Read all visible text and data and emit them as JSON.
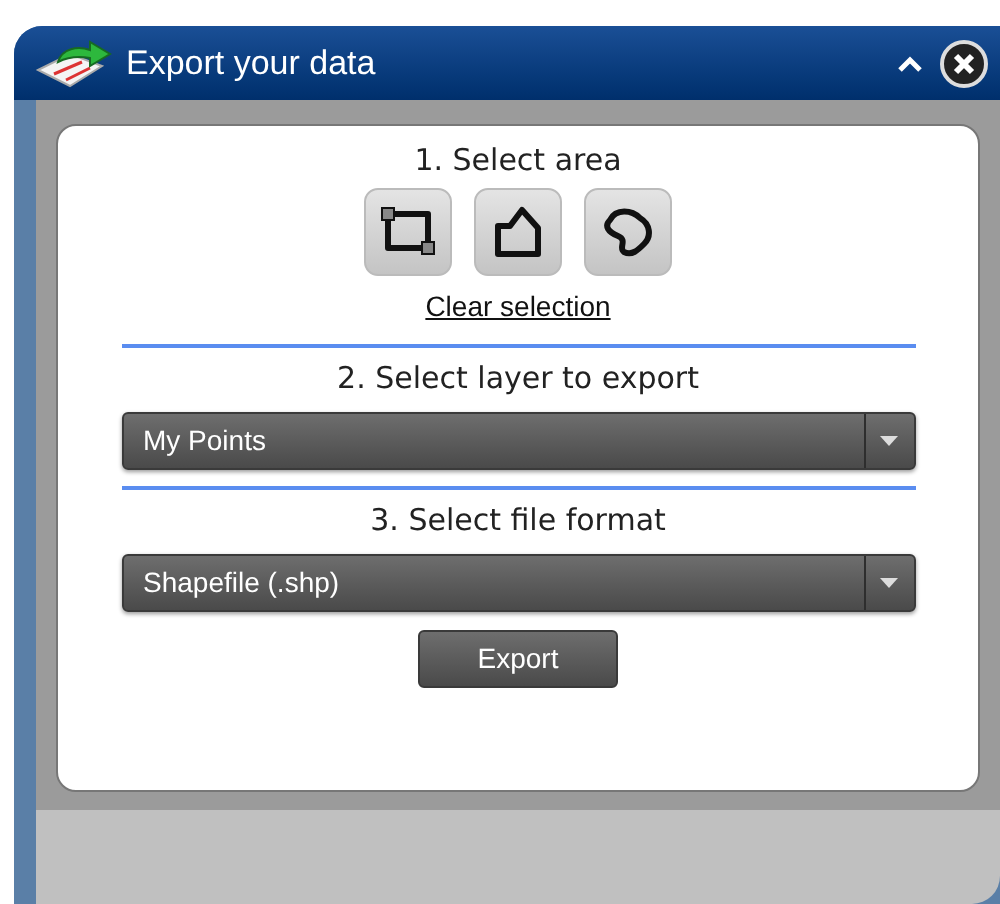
{
  "window": {
    "title": "Export your data"
  },
  "area": {
    "heading": "1. Select area",
    "tools": [
      {
        "kind": "rectangle"
      },
      {
        "kind": "polygon"
      },
      {
        "kind": "freehand"
      }
    ],
    "clear_link": "Clear selection"
  },
  "layer": {
    "heading": "2. Select layer to export",
    "value": "My Points"
  },
  "format": {
    "heading": "3. Select file format",
    "value": "Shapefile (.shp)"
  },
  "buttons": [
    "Export"
  ]
}
